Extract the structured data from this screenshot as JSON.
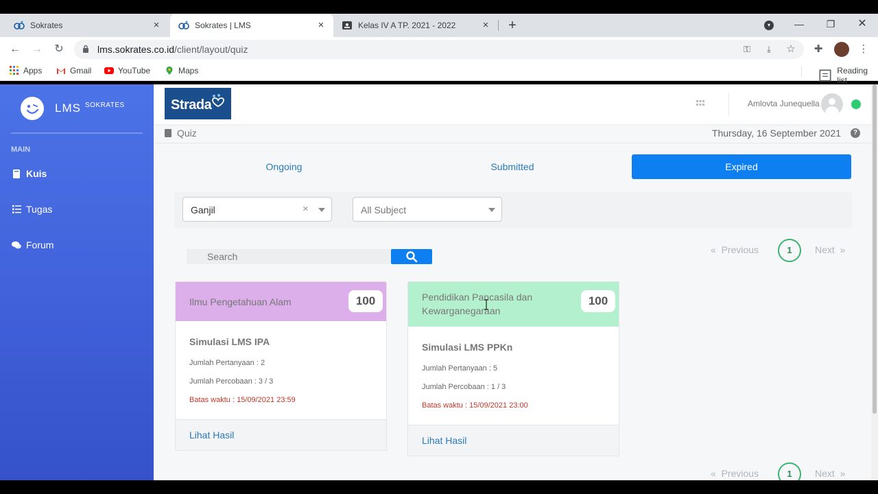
{
  "browser": {
    "tabs": [
      {
        "title": "Sokrates",
        "favicon": "sokrates-icon"
      },
      {
        "title": "Sokrates | LMS",
        "favicon": "sokrates-icon"
      },
      {
        "title": "Kelas IV A TP. 2021 - 2022",
        "favicon": "classroom-icon"
      }
    ],
    "url_host": "lms.sokrates.co.id",
    "url_path": "/client/layout/quiz",
    "bookmarks": [
      "Apps",
      "Gmail",
      "YouTube",
      "Maps"
    ],
    "reading_list": "Reading list"
  },
  "sidebar": {
    "brand": "LMS",
    "brand_sup": "SOKRATES",
    "section": "MAIN",
    "items": [
      {
        "label": "Kuis",
        "icon": "book-icon",
        "active": true
      },
      {
        "label": "Tugas",
        "icon": "list-icon",
        "active": false
      },
      {
        "label": "Forum",
        "icon": "comments-icon",
        "active": false
      }
    ]
  },
  "header": {
    "logo_text": "Strada",
    "user_name": "Amlovta Junequella",
    "status_color": "#2ecc71"
  },
  "breadcrumb": {
    "page": "Quiz",
    "date": "Thursday, 16 September 2021"
  },
  "quiz_tabs": [
    {
      "label": "Ongoing",
      "selected": false
    },
    {
      "label": "Submitted",
      "selected": false
    },
    {
      "label": "Expired",
      "selected": true
    }
  ],
  "filters": {
    "semester": "Ganjil",
    "subject_placeholder": "All Subject"
  },
  "search": {
    "placeholder": "Search"
  },
  "pagination": {
    "previous": "Previous",
    "current": "1",
    "next": "Next"
  },
  "cards": [
    {
      "subject": "Ilmu Pengetahuan Alam",
      "score": "100",
      "header_color": "#dcaeea",
      "title": "Simulasi LMS IPA",
      "questions": "Jumlah Pertanyaan : 2",
      "attempts": "Jumlah Percobaan : 3 / 3",
      "deadline": "Batas waktu : 15/09/2021 23:59",
      "action": "Lihat Hasil"
    },
    {
      "subject": "Pendidikan Pancasila dan Kewarganegaraan",
      "score": "100",
      "header_color": "#b3f0cd",
      "title": "Simulasi LMS PPKn",
      "questions": "Jumlah Pertanyaan : 5",
      "attempts": "Jumlah Percobaan : 1 / 3",
      "deadline": "Batas waktu : 15/09/2021 23:00",
      "action": "Lihat Hasil"
    }
  ],
  "colors": {
    "sidebar": "#4c73e8",
    "primary": "#0d7ff0",
    "link": "#2a7ab8",
    "deadline": "#c0392b"
  }
}
